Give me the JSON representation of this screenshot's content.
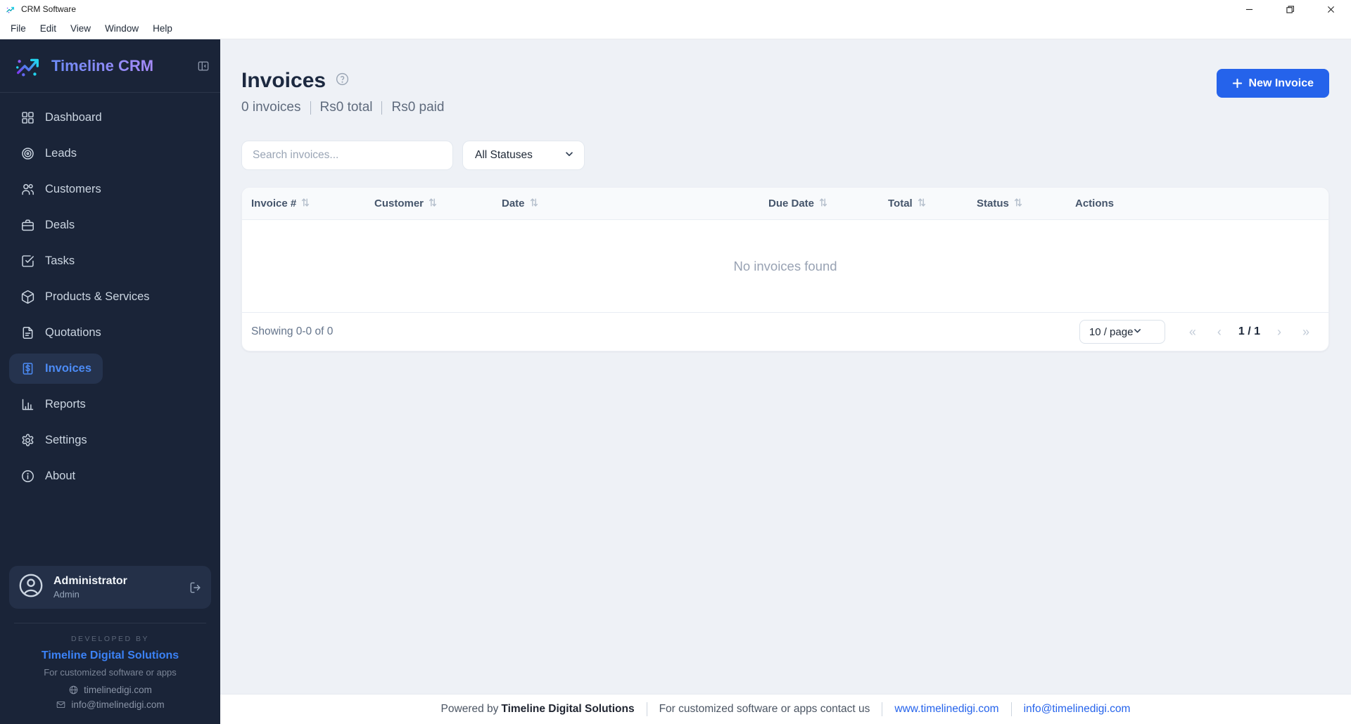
{
  "window": {
    "title": "CRM Software"
  },
  "menu_bar": {
    "items": [
      "File",
      "Edit",
      "View",
      "Window",
      "Help"
    ]
  },
  "sidebar": {
    "brand": "Timeline CRM",
    "items": [
      {
        "label": "Dashboard",
        "icon": "dashboard-icon",
        "active": false
      },
      {
        "label": "Leads",
        "icon": "target-icon",
        "active": false
      },
      {
        "label": "Customers",
        "icon": "users-icon",
        "active": false
      },
      {
        "label": "Deals",
        "icon": "briefcase-icon",
        "active": false
      },
      {
        "label": "Tasks",
        "icon": "check-square-icon",
        "active": false
      },
      {
        "label": "Products & Services",
        "icon": "package-icon",
        "active": false
      },
      {
        "label": "Quotations",
        "icon": "file-text-icon",
        "active": false
      },
      {
        "label": "Invoices",
        "icon": "receipt-icon",
        "active": true
      },
      {
        "label": "Reports",
        "icon": "bar-chart-icon",
        "active": false
      },
      {
        "label": "Settings",
        "icon": "gear-icon",
        "active": false
      },
      {
        "label": "About",
        "icon": "info-icon",
        "active": false
      }
    ],
    "user": {
      "name": "Administrator",
      "role": "Admin"
    },
    "developer": {
      "heading": "DEVELOPED BY",
      "name": "Timeline Digital Solutions",
      "tagline": "For customized software or apps",
      "website": "timelinedigi.com",
      "email": "info@timelinedigi.com"
    }
  },
  "page": {
    "title": "Invoices",
    "stats": [
      "0 invoices",
      "Rs0 total",
      "Rs0 paid"
    ],
    "new_invoice_label": "New Invoice",
    "search_placeholder": "Search invoices...",
    "status_filter": "All Statuses"
  },
  "table": {
    "columns": [
      {
        "label": "Invoice #",
        "sortable": true
      },
      {
        "label": "Customer",
        "sortable": true
      },
      {
        "label": "Date",
        "sortable": true
      },
      {
        "label": "Due Date",
        "sortable": true
      },
      {
        "label": "Total",
        "sortable": true
      },
      {
        "label": "Status",
        "sortable": true
      },
      {
        "label": "Actions",
        "sortable": false
      }
    ],
    "rows": [],
    "empty_message": "No invoices found"
  },
  "pagination": {
    "summary": "Showing 0-0 of 0",
    "page_size": "10 / page",
    "current": "1 / 1",
    "prev_buttons": [
      "«",
      "‹"
    ],
    "next_buttons": [
      "›",
      "»"
    ]
  },
  "footer": {
    "powered_prefix": "Powered by",
    "company": "Timeline Digital Solutions",
    "contact_text": "For customized software or apps contact us",
    "website": "www.timelinedigi.com",
    "email": "info@timelinedigi.com"
  },
  "colors": {
    "accent": "#2563eb",
    "sidebar_bg": "#1a2438",
    "active_link": "#4c8bf5",
    "brand_blue": "#3b82f6"
  }
}
